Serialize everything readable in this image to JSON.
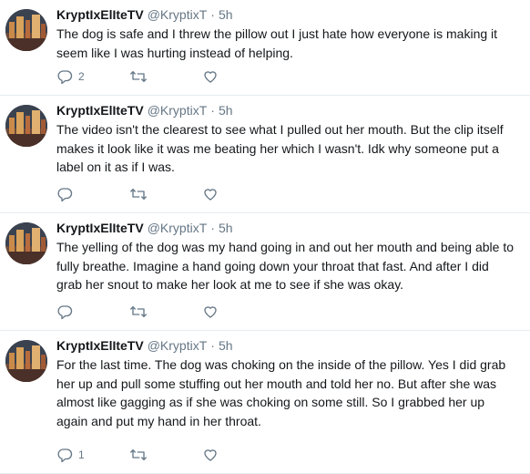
{
  "tweets": [
    {
      "display_name": "KryptIxElIteTV",
      "handle": "@KryptixT",
      "separator": "·",
      "time": "5h",
      "text": "The dog is safe and I threw the pillow out I just hate how everyone is making it seem like I was hurting instead of helping.",
      "reply_count": "2",
      "retweet_count": "",
      "like_count": ""
    },
    {
      "display_name": "KryptIxElIteTV",
      "handle": "@KryptixT",
      "separator": "·",
      "time": "5h",
      "text": "The video isn't the clearest to see what I pulled out her mouth. But the clip itself makes it look like it was me beating her which I wasn't. Idk why someone put a label on it as if I was.",
      "reply_count": "",
      "retweet_count": "",
      "like_count": ""
    },
    {
      "display_name": "KryptIxElIteTV",
      "handle": "@KryptixT",
      "separator": "·",
      "time": "5h",
      "text": "The yelling of the dog was my hand going in and out her mouth and being able to fully breathe. Imagine a hand going down your throat that fast. And after I did grab her snout to make her look at me to see if she was okay.",
      "reply_count": "",
      "retweet_count": "",
      "like_count": ""
    },
    {
      "display_name": "KryptIxElIteTV",
      "handle": "@KryptixT",
      "separator": "·",
      "time": "5h",
      "text": "For the last time. The dog was choking on the inside of the pillow. Yes I did grab her up and pull some stuffing out her mouth and told her no. But after she was almost like gagging as if she was choking on some still. So I grabbed her up again and put my hand in her throat.",
      "reply_count": "1",
      "retweet_count": "",
      "like_count": ""
    }
  ],
  "icons": {
    "reply": "reply-icon",
    "retweet": "retweet-icon",
    "like": "heart-icon"
  },
  "colors": {
    "icon_gray": "#657786",
    "border": "#e6ecf0",
    "text": "#14171a"
  }
}
